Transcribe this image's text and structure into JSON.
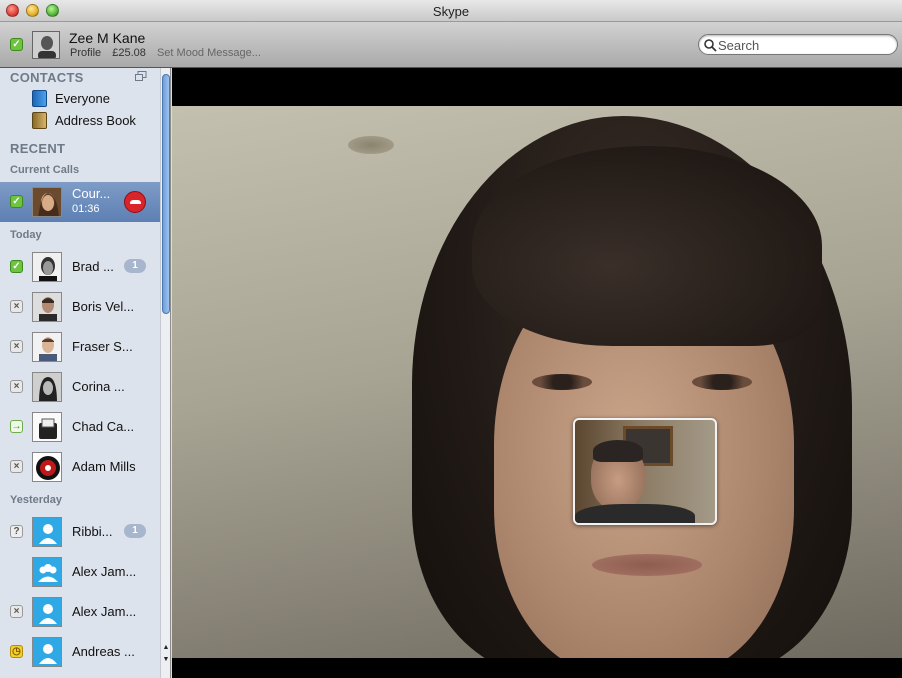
{
  "window": {
    "title": "Skype"
  },
  "profile": {
    "name": "Zee M Kane",
    "profile_link": "Profile",
    "credit": "£25.08",
    "mood_placeholder": "Set Mood Message..."
  },
  "search": {
    "placeholder": "Search"
  },
  "sidebar": {
    "contacts_header": "CONTACTS",
    "nav": [
      {
        "label": "Everyone",
        "icon": "contacts-book-icon"
      },
      {
        "label": "Address Book",
        "icon": "address-book-icon"
      }
    ],
    "recent_header": "RECENT",
    "current_calls_label": "Current Calls",
    "current_call": {
      "name": "Cour...",
      "duration": "01:36",
      "status": "online"
    },
    "today_label": "Today",
    "today": [
      {
        "name": "Brad ...",
        "status": "online",
        "badge": "1"
      },
      {
        "name": "Boris Vel...",
        "status": "offline"
      },
      {
        "name": "Fraser S...",
        "status": "offline"
      },
      {
        "name": "Corina ...",
        "status": "offline"
      },
      {
        "name": "Chad Ca...",
        "status": "forward"
      },
      {
        "name": "Adam Mills",
        "status": "offline"
      }
    ],
    "yesterday_label": "Yesterday",
    "yesterday": [
      {
        "name": "Ribbi...",
        "status": "unknown",
        "badge": "1"
      },
      {
        "name": "Alex Jam...",
        "status": "none"
      },
      {
        "name": "Alex Jam...",
        "status": "offline"
      },
      {
        "name": "Andreas ...",
        "status": "away"
      }
    ]
  },
  "colors": {
    "online": "#6dc43f",
    "hangup": "#d8242a",
    "selection": "#6f8dbd"
  }
}
